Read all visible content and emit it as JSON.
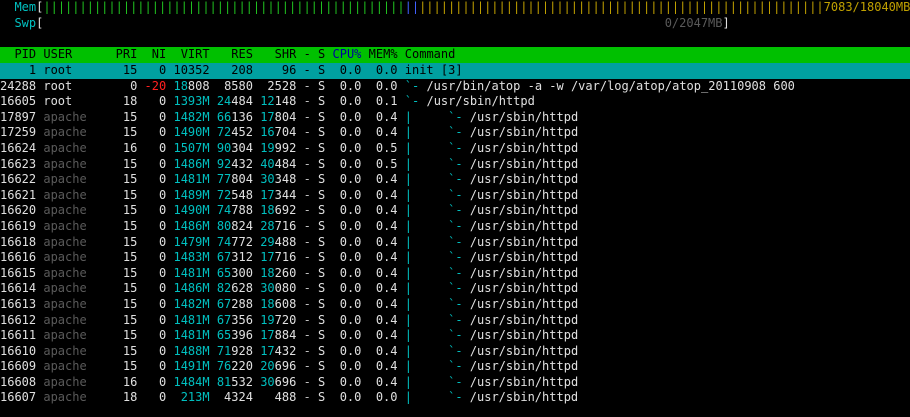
{
  "meters": {
    "mem_label": "Mem",
    "mem_bar_green": "||||||||||||||||||||||||||||||||||||||||||||||||||",
    "mem_bar_blue": "||",
    "mem_bar_yellow": "||||||||||||||||||||||||||||||||||||||||||||||||||||||||",
    "mem_value": "7083/18040MB",
    "swp_label": "Swp",
    "swp_value": "0/2047MB"
  },
  "header": {
    "pid": "PID",
    "user": "USER",
    "pri": "PRI",
    "ni": "NI",
    "virt": "VIRT",
    "res": "RES",
    "shr": "SHR",
    "s": "S",
    "cpu": "CPU%",
    "mem": "MEM%",
    "command": "Command"
  },
  "processes": [
    {
      "pid": "1",
      "user": "root",
      "pri": "15",
      "ni": "0",
      "virt": "10352",
      "res": "208",
      "shr": "96",
      "s": "S",
      "cpu": "0.0",
      "mem": "0.0",
      "tree": "",
      "cmd": "init [3]"
    },
    {
      "pid": "24288",
      "user": "root",
      "pri": "0",
      "ni": "-20",
      "virt": "18808",
      "res": "8580",
      "shr": "2528",
      "s": "S",
      "cpu": "0.0",
      "mem": "0.0",
      "tree": "`- ",
      "cmd": "/usr/bin/atop -a -w /var/log/atop/atop_20110908 600"
    },
    {
      "pid": "16605",
      "user": "root",
      "pri": "18",
      "ni": "0",
      "virt": "1393M",
      "res": "24484",
      "shr": "12148",
      "s": "S",
      "cpu": "0.0",
      "mem": "0.1",
      "tree": "`- ",
      "cmd": "/usr/sbin/httpd"
    },
    {
      "pid": "17897",
      "user": "apache",
      "pri": "15",
      "ni": "0",
      "virt": "1482M",
      "res": "66136",
      "shr": "17804",
      "s": "S",
      "cpu": "0.0",
      "mem": "0.4",
      "tree": "|     `- ",
      "cmd": "/usr/sbin/httpd"
    },
    {
      "pid": "17259",
      "user": "apache",
      "pri": "15",
      "ni": "0",
      "virt": "1490M",
      "res": "72452",
      "shr": "16704",
      "s": "S",
      "cpu": "0.0",
      "mem": "0.4",
      "tree": "|     `- ",
      "cmd": "/usr/sbin/httpd"
    },
    {
      "pid": "16624",
      "user": "apache",
      "pri": "16",
      "ni": "0",
      "virt": "1507M",
      "res": "90304",
      "shr": "19992",
      "s": "S",
      "cpu": "0.0",
      "mem": "0.5",
      "tree": "|     `- ",
      "cmd": "/usr/sbin/httpd"
    },
    {
      "pid": "16623",
      "user": "apache",
      "pri": "15",
      "ni": "0",
      "virt": "1486M",
      "res": "92432",
      "shr": "40484",
      "s": "S",
      "cpu": "0.0",
      "mem": "0.5",
      "tree": "|     `- ",
      "cmd": "/usr/sbin/httpd"
    },
    {
      "pid": "16622",
      "user": "apache",
      "pri": "15",
      "ni": "0",
      "virt": "1481M",
      "res": "77804",
      "shr": "30348",
      "s": "S",
      "cpu": "0.0",
      "mem": "0.4",
      "tree": "|     `- ",
      "cmd": "/usr/sbin/httpd"
    },
    {
      "pid": "16621",
      "user": "apache",
      "pri": "15",
      "ni": "0",
      "virt": "1489M",
      "res": "72548",
      "shr": "17344",
      "s": "S",
      "cpu": "0.0",
      "mem": "0.4",
      "tree": "|     `- ",
      "cmd": "/usr/sbin/httpd"
    },
    {
      "pid": "16620",
      "user": "apache",
      "pri": "15",
      "ni": "0",
      "virt": "1490M",
      "res": "74788",
      "shr": "18692",
      "s": "S",
      "cpu": "0.0",
      "mem": "0.4",
      "tree": "|     `- ",
      "cmd": "/usr/sbin/httpd"
    },
    {
      "pid": "16619",
      "user": "apache",
      "pri": "15",
      "ni": "0",
      "virt": "1486M",
      "res": "80824",
      "shr": "28716",
      "s": "S",
      "cpu": "0.0",
      "mem": "0.4",
      "tree": "|     `- ",
      "cmd": "/usr/sbin/httpd"
    },
    {
      "pid": "16618",
      "user": "apache",
      "pri": "15",
      "ni": "0",
      "virt": "1479M",
      "res": "74772",
      "shr": "29488",
      "s": "S",
      "cpu": "0.0",
      "mem": "0.4",
      "tree": "|     `- ",
      "cmd": "/usr/sbin/httpd"
    },
    {
      "pid": "16616",
      "user": "apache",
      "pri": "15",
      "ni": "0",
      "virt": "1483M",
      "res": "67312",
      "shr": "17716",
      "s": "S",
      "cpu": "0.0",
      "mem": "0.4",
      "tree": "|     `- ",
      "cmd": "/usr/sbin/httpd"
    },
    {
      "pid": "16615",
      "user": "apache",
      "pri": "15",
      "ni": "0",
      "virt": "1481M",
      "res": "65300",
      "shr": "18260",
      "s": "S",
      "cpu": "0.0",
      "mem": "0.4",
      "tree": "|     `- ",
      "cmd": "/usr/sbin/httpd"
    },
    {
      "pid": "16614",
      "user": "apache",
      "pri": "15",
      "ni": "0",
      "virt": "1486M",
      "res": "82628",
      "shr": "30080",
      "s": "S",
      "cpu": "0.0",
      "mem": "0.4",
      "tree": "|     `- ",
      "cmd": "/usr/sbin/httpd"
    },
    {
      "pid": "16613",
      "user": "apache",
      "pri": "15",
      "ni": "0",
      "virt": "1482M",
      "res": "67288",
      "shr": "18608",
      "s": "S",
      "cpu": "0.0",
      "mem": "0.4",
      "tree": "|     `- ",
      "cmd": "/usr/sbin/httpd"
    },
    {
      "pid": "16612",
      "user": "apache",
      "pri": "15",
      "ni": "0",
      "virt": "1481M",
      "res": "67356",
      "shr": "19720",
      "s": "S",
      "cpu": "0.0",
      "mem": "0.4",
      "tree": "|     `- ",
      "cmd": "/usr/sbin/httpd"
    },
    {
      "pid": "16611",
      "user": "apache",
      "pri": "15",
      "ni": "0",
      "virt": "1481M",
      "res": "65396",
      "shr": "17884",
      "s": "S",
      "cpu": "0.0",
      "mem": "0.4",
      "tree": "|     `- ",
      "cmd": "/usr/sbin/httpd"
    },
    {
      "pid": "16610",
      "user": "apache",
      "pri": "15",
      "ni": "0",
      "virt": "1488M",
      "res": "71928",
      "shr": "17432",
      "s": "S",
      "cpu": "0.0",
      "mem": "0.4",
      "tree": "|     `- ",
      "cmd": "/usr/sbin/httpd"
    },
    {
      "pid": "16609",
      "user": "apache",
      "pri": "15",
      "ni": "0",
      "virt": "1491M",
      "res": "76220",
      "shr": "20696",
      "s": "S",
      "cpu": "0.0",
      "mem": "0.4",
      "tree": "|     `- ",
      "cmd": "/usr/sbin/httpd"
    },
    {
      "pid": "16608",
      "user": "apache",
      "pri": "16",
      "ni": "0",
      "virt": "1484M",
      "res": "81532",
      "shr": "30696",
      "s": "S",
      "cpu": "0.0",
      "mem": "0.4",
      "tree": "|     `- ",
      "cmd": "/usr/sbin/httpd"
    },
    {
      "pid": "16607",
      "user": "apache",
      "pri": "18",
      "ni": "0",
      "virt": "213M",
      "res": "4324",
      "shr": "488",
      "s": "S",
      "cpu": "0.0",
      "mem": "0.0",
      "tree": "|     `- ",
      "cmd": "/usr/sbin/httpd"
    }
  ]
}
